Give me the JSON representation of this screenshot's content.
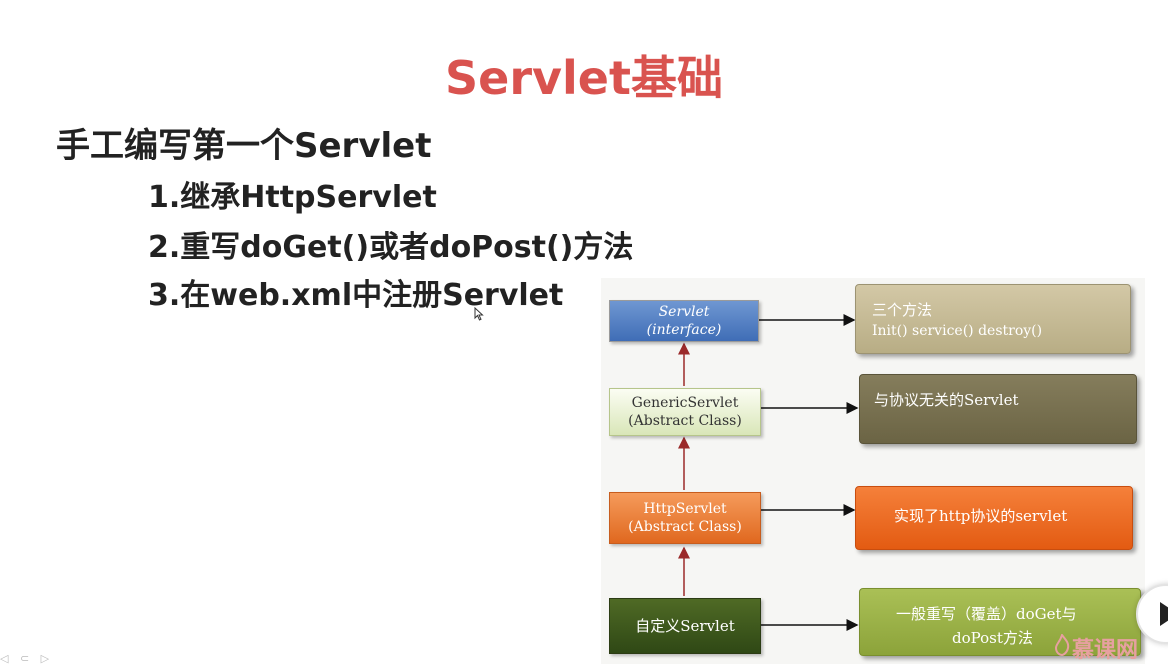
{
  "slide": {
    "title": "Servlet基础",
    "heading": "手工编写第一个Servlet",
    "steps": [
      "1.继承HttpServlet",
      "2.重写doGet()或者doPost()方法",
      "3.在web.xml中注册Servlet"
    ]
  },
  "diagram": {
    "nodes": [
      {
        "line1": "Servlet",
        "line2": "(interface)"
      },
      {
        "line1": "GenericServlet",
        "line2": "(Abstract  Class)"
      },
      {
        "line1": "HttpServlet",
        "line2": "(Abstract  Class)"
      },
      {
        "line1": "自定义Servlet",
        "line2": ""
      }
    ],
    "notes": [
      {
        "line1": "三个方法",
        "line2": "Init() service() destroy()"
      },
      {
        "line1": "与协议无关的Servlet",
        "line2": ""
      },
      {
        "line1": "实现了http协议的servlet",
        "line2": ""
      },
      {
        "line1": "一般重写（覆盖）doGet与",
        "line2": "doPost方法"
      }
    ]
  },
  "overlay": {
    "watermark": "慕课网",
    "play_icon": "play-icon",
    "toolbar_icons": "◁ ⊂ ▷"
  }
}
